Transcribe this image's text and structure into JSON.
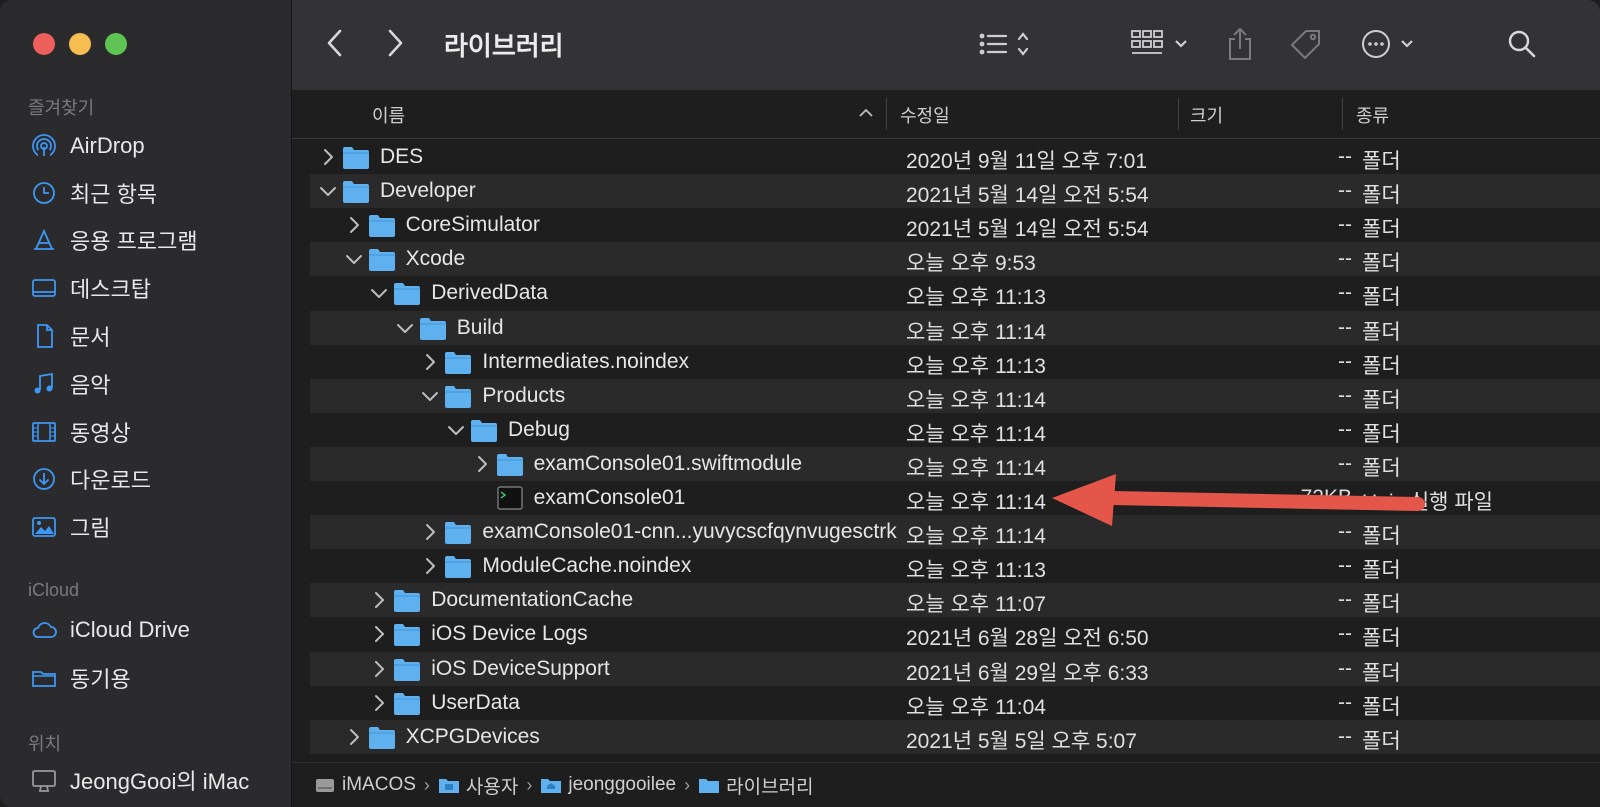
{
  "window": {
    "title": "라이브러리"
  },
  "sidebar": {
    "favorites_label": "즐겨찾기",
    "favorites": [
      {
        "label": "AirDrop",
        "icon": "airdrop-icon"
      },
      {
        "label": "최근 항목",
        "icon": "clock-icon"
      },
      {
        "label": "응용 프로그램",
        "icon": "applications-icon"
      },
      {
        "label": "데스크탑",
        "icon": "desktop-icon"
      },
      {
        "label": "문서",
        "icon": "document-icon"
      },
      {
        "label": "음악",
        "icon": "music-icon"
      },
      {
        "label": "동영상",
        "icon": "film-icon"
      },
      {
        "label": "다운로드",
        "icon": "download-icon"
      },
      {
        "label": "그림",
        "icon": "picture-icon"
      }
    ],
    "icloud_label": "iCloud",
    "icloud": [
      {
        "label": "iCloud Drive",
        "icon": "cloud-icon"
      },
      {
        "label": "동기용",
        "icon": "folder-icon"
      }
    ],
    "locations_label": "위치",
    "locations": [
      {
        "label": "JeongGooi의 iMac",
        "icon": "imac-icon"
      }
    ]
  },
  "columns": {
    "name": "이름",
    "modified": "수정일",
    "size": "크기",
    "kind": "종류"
  },
  "rows": [
    {
      "name": "DES",
      "date": "2020년 9월 11일 오후 7:01",
      "size": "--",
      "kind": "폴더"
    },
    {
      "name": "Developer",
      "date": "2021년 5월 14일 오전 5:54",
      "size": "--",
      "kind": "폴더"
    },
    {
      "name": "CoreSimulator",
      "date": "2021년 5월 14일 오전 5:54",
      "size": "--",
      "kind": "폴더"
    },
    {
      "name": "Xcode",
      "date": "오늘 오후 9:53",
      "size": "--",
      "kind": "폴더"
    },
    {
      "name": "DerivedData",
      "date": "오늘 오후 11:13",
      "size": "--",
      "kind": "폴더"
    },
    {
      "name": "Build",
      "date": "오늘 오후 11:14",
      "size": "--",
      "kind": "폴더"
    },
    {
      "name": "Intermediates.noindex",
      "date": "오늘 오후 11:13",
      "size": "--",
      "kind": "폴더"
    },
    {
      "name": "Products",
      "date": "오늘 오후 11:14",
      "size": "--",
      "kind": "폴더"
    },
    {
      "name": "Debug",
      "date": "오늘 오후 11:14",
      "size": "--",
      "kind": "폴더"
    },
    {
      "name": "examConsole01.swiftmodule",
      "date": "오늘 오후 11:14",
      "size": "--",
      "kind": "폴더"
    },
    {
      "name": "examConsole01",
      "date": "오늘 오후 11:14",
      "size": "72KB",
      "kind": "Unix 실행 파일"
    },
    {
      "name": "examConsole01-cnn...yuvycscfqynvugesctrk",
      "date": "오늘 오후 11:14",
      "size": "--",
      "kind": "폴더"
    },
    {
      "name": "ModuleCache.noindex",
      "date": "오늘 오후 11:13",
      "size": "--",
      "kind": "폴더"
    },
    {
      "name": "DocumentationCache",
      "date": "오늘 오후 11:07",
      "size": "--",
      "kind": "폴더"
    },
    {
      "name": "iOS Device Logs",
      "date": "2021년 6월 28일 오전 6:50",
      "size": "--",
      "kind": "폴더"
    },
    {
      "name": "iOS DeviceSupport",
      "date": "2021년 6월 29일 오후 6:33",
      "size": "--",
      "kind": "폴더"
    },
    {
      "name": "UserData",
      "date": "오늘 오후 11:04",
      "size": "--",
      "kind": "폴더"
    },
    {
      "name": "XCPGDevices",
      "date": "2021년 5월 5일 오후 5:07",
      "size": "--",
      "kind": "폴더"
    }
  ],
  "pathbar": [
    {
      "label": "iMACOS",
      "icon": "disk-icon"
    },
    {
      "label": "사용자",
      "icon": "folder-icon"
    },
    {
      "label": "jeonggooilee",
      "icon": "home-folder-icon"
    },
    {
      "label": "라이브러리",
      "icon": "folder-icon"
    }
  ],
  "colors": {
    "folder": "#5fb0ee",
    "annotation_arrow": "#e5564a",
    "accent": "#0a84ff"
  }
}
